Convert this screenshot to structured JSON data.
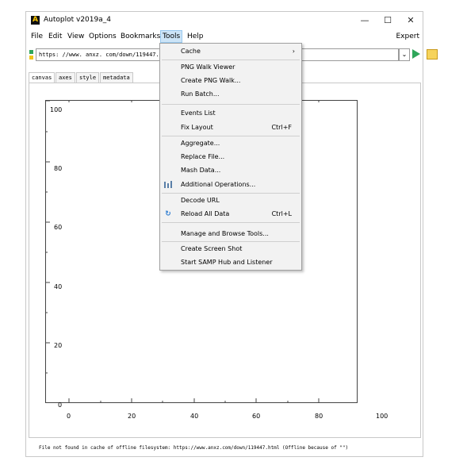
{
  "window": {
    "title": "Autoplot v2019a_4",
    "controls": {
      "minimize": "—",
      "maximize": "☐",
      "close": "✕"
    }
  },
  "menubar": {
    "items": [
      "File",
      "Edit",
      "View",
      "Options",
      "Bookmarks",
      "Tools",
      "Help"
    ],
    "active": "Tools",
    "expert": "Expert"
  },
  "urlbar": {
    "value": "https: //www. anxz. com/down/119447. html",
    "dropdown": "⌄"
  },
  "tabs": [
    "canvas",
    "axes",
    "style",
    "metadata"
  ],
  "plot": {
    "y_ticks": [
      "100",
      "80",
      "60",
      "40",
      "20",
      "0"
    ],
    "x_ticks": [
      "0",
      "20",
      "40",
      "60",
      "80",
      "100"
    ]
  },
  "status": "File not found in cache of offline filesystem: https://www.anxz.com/down/119447.html (Offline because of \"\")",
  "tools_menu": {
    "items": [
      {
        "label": "Cache",
        "submenu": "›"
      },
      {
        "label": "PNG Walk Viewer"
      },
      {
        "label": "Create PNG Walk..."
      },
      {
        "label": "Run Batch..."
      },
      {
        "label": "Events List"
      },
      {
        "label": "Fix Layout",
        "accel": "Ctrl+F"
      },
      {
        "label": "Aggregate..."
      },
      {
        "label": "Replace File..."
      },
      {
        "label": "Mash Data..."
      },
      {
        "label": "Additional Operations...",
        "icon": "operations-icon"
      },
      {
        "label": "Decode URL"
      },
      {
        "label": "Reload All Data",
        "accel": "Ctrl+L",
        "icon": "reload-icon"
      },
      {
        "label": "Manage and Browse Tools..."
      },
      {
        "label": "Create Screen Shot"
      },
      {
        "label": "Start SAMP Hub and Listener"
      }
    ]
  },
  "colors": {
    "accent": "#cce4f7",
    "go": "#2fa65a",
    "folder": "#f6d35b"
  }
}
